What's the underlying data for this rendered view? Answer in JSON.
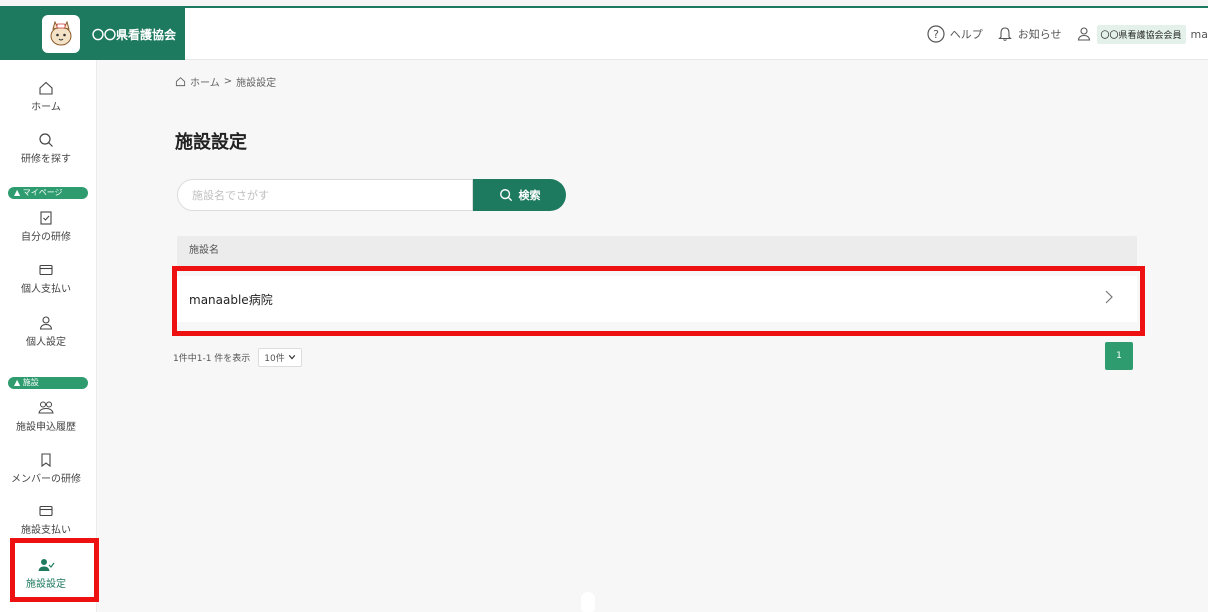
{
  "header": {
    "org_name": "〇〇県看護協会",
    "help": "ヘルプ",
    "notifications": "お知らせ",
    "member_badge": "〇〇県看護協会会員",
    "username": "ma"
  },
  "sidebar": {
    "home": "ホーム",
    "search": "研修を探す",
    "mypage_section": "マイページ",
    "my_training": "自分の研修",
    "personal_payment": "個人支払い",
    "personal_settings": "個人設定",
    "facility_section": "施設",
    "facility_history": "施設申込履歴",
    "member_training": "メンバーの研修",
    "facility_payment": "施設支払い",
    "facility_settings": "施設設定"
  },
  "breadcrumb": {
    "home": "ホーム",
    "separator": ">",
    "current": "施設設定"
  },
  "page": {
    "title": "施設設定"
  },
  "search": {
    "placeholder": "施設名でさがす",
    "button": "検索"
  },
  "table": {
    "column": "施設名",
    "rows": [
      {
        "name": "manaable病院"
      }
    ]
  },
  "pagination": {
    "summary": "1件中1-1 件を表示",
    "per_page": "10件",
    "current_page": "1"
  },
  "colors": {
    "brand": "#1e7a5f",
    "accent": "#2f9c70",
    "highlight": "#ee1111"
  }
}
